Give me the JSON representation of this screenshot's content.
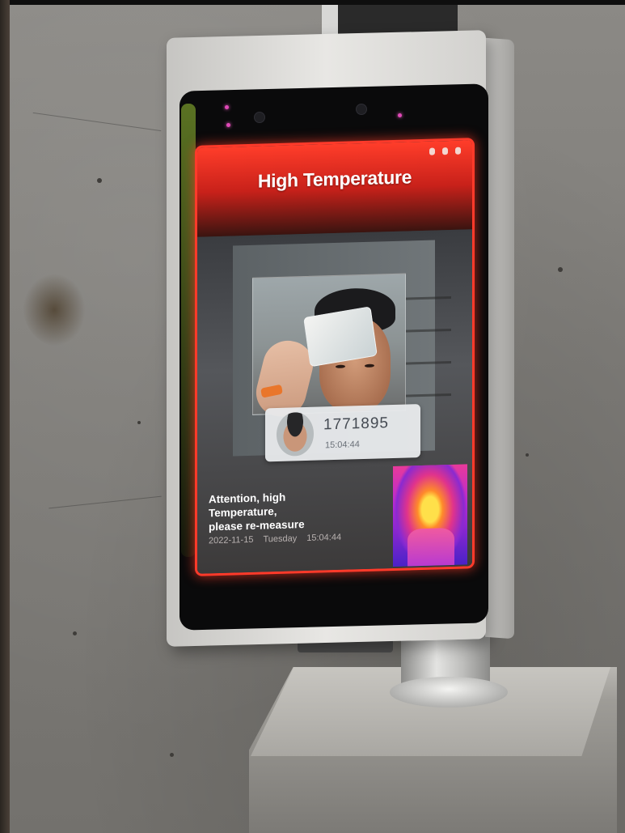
{
  "screen": {
    "title": "High Temperature",
    "status_icons": [
      "lock-icon",
      "sound-icon",
      "settings-icon"
    ],
    "recognition": {
      "id_number": "1771895",
      "time": "15:04:44"
    },
    "warning_line1": "Attention, high Temperature,",
    "warning_line2": "please re-measure",
    "footer": {
      "date": "2022-11-15",
      "weekday": "Tuesday",
      "time": "15:04:44"
    }
  },
  "colors": {
    "alert_red": "#ff3a2a",
    "header_text": "#ffffff",
    "card_bg": "#e8eaec"
  }
}
